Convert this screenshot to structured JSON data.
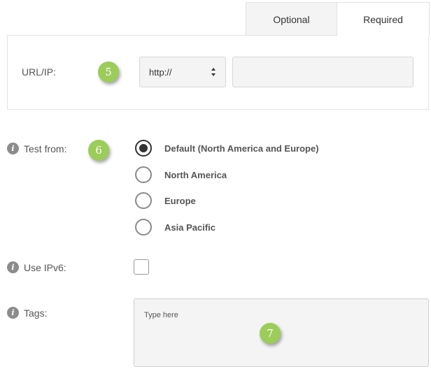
{
  "tabs": [
    {
      "label": "Optional",
      "active": false
    },
    {
      "label": "Required",
      "active": true
    }
  ],
  "url": {
    "label": "URL/IP:",
    "badge": "5",
    "protocol": {
      "selected": "http://"
    },
    "value": ""
  },
  "test_from": {
    "label": "Test from:",
    "badge": "6",
    "options": [
      {
        "label": "Default (North America and Europe)",
        "checked": true
      },
      {
        "label": "North America",
        "checked": false
      },
      {
        "label": "Europe",
        "checked": false
      },
      {
        "label": "Asia Pacific",
        "checked": false
      }
    ]
  },
  "ipv6": {
    "label": "Use IPv6:",
    "checked": false
  },
  "tags": {
    "label": "Tags:",
    "placeholder": "Type here",
    "badge": "7"
  },
  "icons": {
    "info": "info-icon",
    "select_arrows": "up-down-arrows-icon"
  },
  "colors": {
    "badge": "#9ccc5a",
    "info_icon": "#8c8c8c",
    "field_bg": "#f4f4f4",
    "border": "#e2e2e2"
  }
}
